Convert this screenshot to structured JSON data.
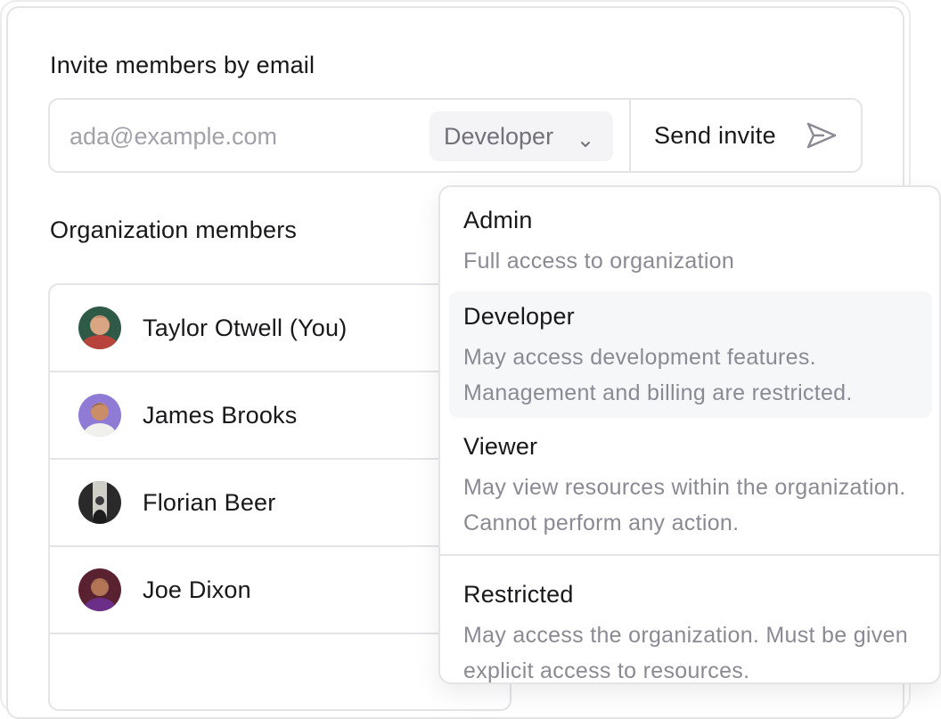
{
  "invite": {
    "label": "Invite members by email",
    "email_placeholder": "ada@example.com",
    "email_value": "",
    "role_selected": "Developer",
    "send_label": "Send invite"
  },
  "members": {
    "label": "Organization members",
    "list": [
      {
        "name": "Taylor Otwell (You)"
      },
      {
        "name": "James Brooks"
      },
      {
        "name": "Florian Beer"
      },
      {
        "name": "Joe Dixon"
      }
    ]
  },
  "role_options": [
    {
      "title": "Admin",
      "desc": "Full access to organization"
    },
    {
      "title": "Developer",
      "desc": "May access development features. Management and billing are restricted."
    },
    {
      "title": "Viewer",
      "desc": "May view resources within the organization. Cannot perform any action."
    },
    {
      "title": "Restricted",
      "desc": "May access the organization. Must be given explicit access to resources."
    }
  ],
  "icons": {
    "role_chevron": "chevron-down-icon",
    "send": "send-icon"
  },
  "colors": {
    "text": "#18181b",
    "muted": "#71717a",
    "border": "#e4e4e7",
    "highlight": "#f6f7f9"
  }
}
